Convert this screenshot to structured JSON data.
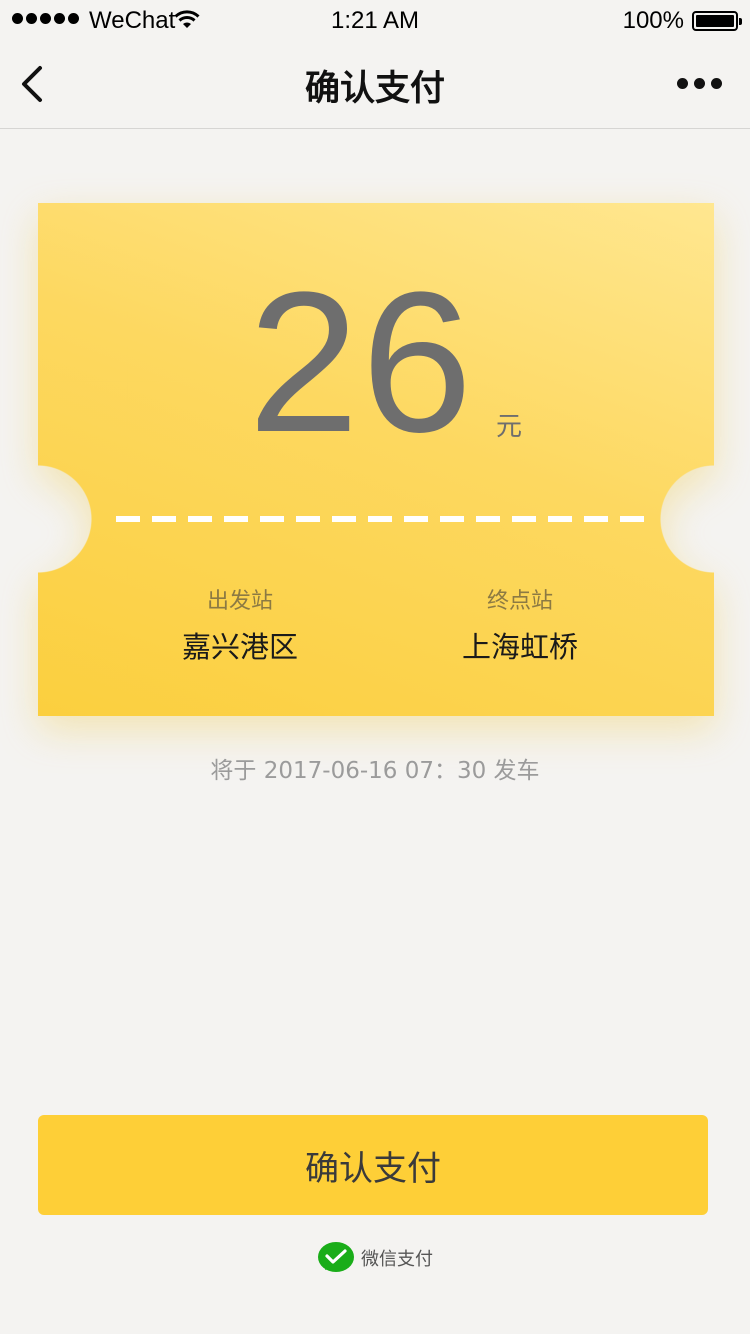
{
  "status_bar": {
    "carrier": "WeChat",
    "time": "1:21 AM",
    "battery": "100%"
  },
  "nav": {
    "title": "确认支付"
  },
  "ticket": {
    "amount": "26",
    "unit": "元",
    "from_label": "出发站",
    "from_station": "嘉兴港区",
    "to_label": "终点站",
    "to_station": "上海虹桥"
  },
  "departure": "将于 2017-06-16  07：30 发车",
  "pay_button": "确认支付",
  "payment_method": "微信支付",
  "colors": {
    "accent": "#fecf37",
    "background": "#f4f3f1",
    "wechat_green": "#1aad19"
  }
}
